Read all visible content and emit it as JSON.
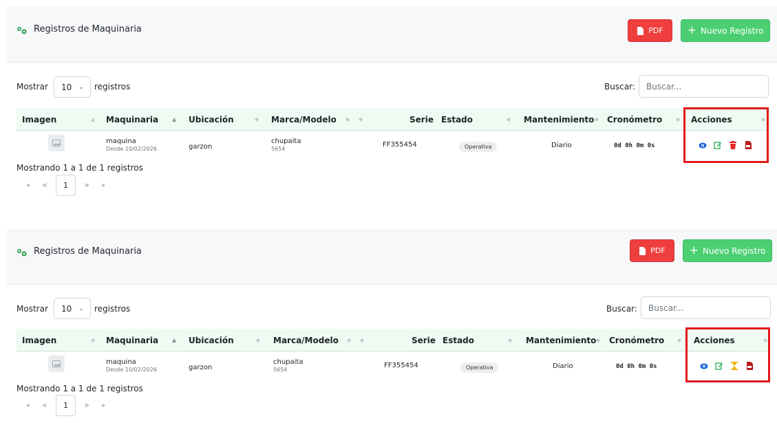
{
  "panels": [
    {
      "title": "Registros de Maquinaria",
      "pdf_label": "PDF",
      "new_label": "Nuevo Registro",
      "show_label": "Mostrar",
      "page_size": "10",
      "records_label": "registros",
      "search_label": "Buscar:",
      "search_placeholder": "Buscar...",
      "columns": [
        "Imagen",
        "Maquinaria",
        "Ubicación",
        "Marca/Modelo",
        "Serie",
        "Estado",
        "Mantenimiento",
        "Cronómetro",
        "Acciones"
      ],
      "row": {
        "maquinaria": "maquina",
        "desde": "Desde 10/02/2026",
        "ubicacion": "garzon",
        "marca": "chupaita",
        "modelo": "5654",
        "serie": "FF355454",
        "estado": "Operativa",
        "mantenimiento": "Diario",
        "cronometro": "0d 0h 0m 0s",
        "actions": [
          "view-icon",
          "edit-icon",
          "delete-icon",
          "pdf-icon"
        ]
      },
      "info": "Mostrando 1 a 1 de 1 registros",
      "pager": {
        "first": "«",
        "prev": "<",
        "current": "1",
        "next": ">",
        "last": "»"
      }
    },
    {
      "title": "Registros de Maquinaria",
      "pdf_label": "PDF",
      "new_label": "Nuevo Registro",
      "show_label": "Mostrar",
      "page_size": "10",
      "records_label": "registros",
      "search_label": "Buscar:",
      "search_placeholder": "Buscar...",
      "columns": [
        "Imagen",
        "Maquinaria",
        "Ubicación",
        "Marca/Modelo",
        "Serie",
        "Estado",
        "Mantenimiento",
        "Cronómetro",
        "Acciones"
      ],
      "row": {
        "maquinaria": "maquina",
        "desde": "Desde 10/02/2026",
        "ubicacion": "garzon",
        "marca": "chupaita",
        "modelo": "5654",
        "serie": "FF355454",
        "estado": "Operativa",
        "mantenimiento": "Diario",
        "cronometro": "0d 0h 0m 0s",
        "actions": [
          "view-icon",
          "edit-icon",
          "hourglass-icon",
          "pdf-icon"
        ]
      },
      "info": "Mostrando 1 a 1 de 1 registros",
      "pager": {
        "first": "«",
        "prev": "<",
        "current": "1",
        "next": ">",
        "last": "»"
      }
    }
  ],
  "colors": {
    "pdf_button": "#ef3e3e",
    "new_button": "#4ccf73",
    "highlight": "#e11919",
    "view": "#1565d8",
    "edit": "#35b55a",
    "delete": "#e32626",
    "hourglass": "#f0b400",
    "pdf_icon": "#b91c1c"
  }
}
